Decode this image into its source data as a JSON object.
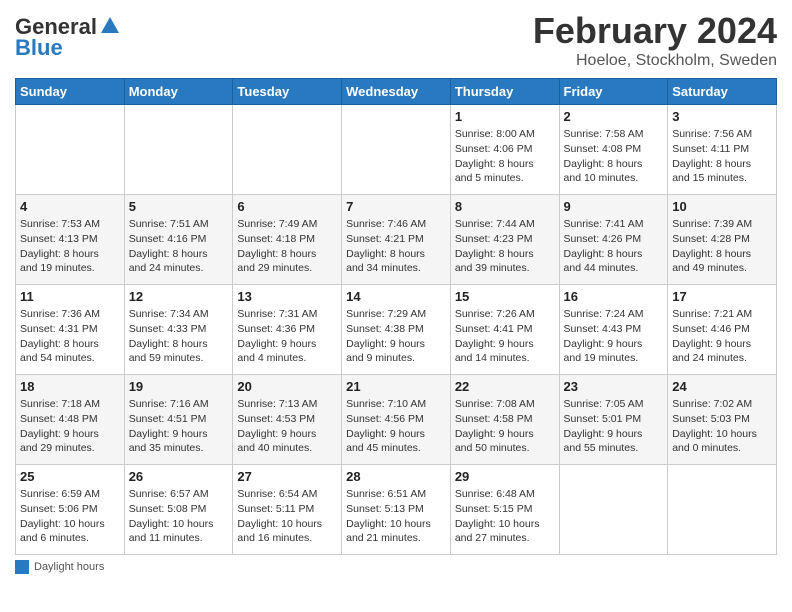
{
  "header": {
    "logo_general": "General",
    "logo_blue": "Blue",
    "month_title": "February 2024",
    "location": "Hoeloe, Stockholm, Sweden"
  },
  "weekdays": [
    "Sunday",
    "Monday",
    "Tuesday",
    "Wednesday",
    "Thursday",
    "Friday",
    "Saturday"
  ],
  "footer_label": "Daylight hours",
  "weeks": [
    [
      {
        "day": "",
        "info": ""
      },
      {
        "day": "",
        "info": ""
      },
      {
        "day": "",
        "info": ""
      },
      {
        "day": "",
        "info": ""
      },
      {
        "day": "1",
        "info": "Sunrise: 8:00 AM\nSunset: 4:06 PM\nDaylight: 8 hours\nand 5 minutes."
      },
      {
        "day": "2",
        "info": "Sunrise: 7:58 AM\nSunset: 4:08 PM\nDaylight: 8 hours\nand 10 minutes."
      },
      {
        "day": "3",
        "info": "Sunrise: 7:56 AM\nSunset: 4:11 PM\nDaylight: 8 hours\nand 15 minutes."
      }
    ],
    [
      {
        "day": "4",
        "info": "Sunrise: 7:53 AM\nSunset: 4:13 PM\nDaylight: 8 hours\nand 19 minutes."
      },
      {
        "day": "5",
        "info": "Sunrise: 7:51 AM\nSunset: 4:16 PM\nDaylight: 8 hours\nand 24 minutes."
      },
      {
        "day": "6",
        "info": "Sunrise: 7:49 AM\nSunset: 4:18 PM\nDaylight: 8 hours\nand 29 minutes."
      },
      {
        "day": "7",
        "info": "Sunrise: 7:46 AM\nSunset: 4:21 PM\nDaylight: 8 hours\nand 34 minutes."
      },
      {
        "day": "8",
        "info": "Sunrise: 7:44 AM\nSunset: 4:23 PM\nDaylight: 8 hours\nand 39 minutes."
      },
      {
        "day": "9",
        "info": "Sunrise: 7:41 AM\nSunset: 4:26 PM\nDaylight: 8 hours\nand 44 minutes."
      },
      {
        "day": "10",
        "info": "Sunrise: 7:39 AM\nSunset: 4:28 PM\nDaylight: 8 hours\nand 49 minutes."
      }
    ],
    [
      {
        "day": "11",
        "info": "Sunrise: 7:36 AM\nSunset: 4:31 PM\nDaylight: 8 hours\nand 54 minutes."
      },
      {
        "day": "12",
        "info": "Sunrise: 7:34 AM\nSunset: 4:33 PM\nDaylight: 8 hours\nand 59 minutes."
      },
      {
        "day": "13",
        "info": "Sunrise: 7:31 AM\nSunset: 4:36 PM\nDaylight: 9 hours\nand 4 minutes."
      },
      {
        "day": "14",
        "info": "Sunrise: 7:29 AM\nSunset: 4:38 PM\nDaylight: 9 hours\nand 9 minutes."
      },
      {
        "day": "15",
        "info": "Sunrise: 7:26 AM\nSunset: 4:41 PM\nDaylight: 9 hours\nand 14 minutes."
      },
      {
        "day": "16",
        "info": "Sunrise: 7:24 AM\nSunset: 4:43 PM\nDaylight: 9 hours\nand 19 minutes."
      },
      {
        "day": "17",
        "info": "Sunrise: 7:21 AM\nSunset: 4:46 PM\nDaylight: 9 hours\nand 24 minutes."
      }
    ],
    [
      {
        "day": "18",
        "info": "Sunrise: 7:18 AM\nSunset: 4:48 PM\nDaylight: 9 hours\nand 29 minutes."
      },
      {
        "day": "19",
        "info": "Sunrise: 7:16 AM\nSunset: 4:51 PM\nDaylight: 9 hours\nand 35 minutes."
      },
      {
        "day": "20",
        "info": "Sunrise: 7:13 AM\nSunset: 4:53 PM\nDaylight: 9 hours\nand 40 minutes."
      },
      {
        "day": "21",
        "info": "Sunrise: 7:10 AM\nSunset: 4:56 PM\nDaylight: 9 hours\nand 45 minutes."
      },
      {
        "day": "22",
        "info": "Sunrise: 7:08 AM\nSunset: 4:58 PM\nDaylight: 9 hours\nand 50 minutes."
      },
      {
        "day": "23",
        "info": "Sunrise: 7:05 AM\nSunset: 5:01 PM\nDaylight: 9 hours\nand 55 minutes."
      },
      {
        "day": "24",
        "info": "Sunrise: 7:02 AM\nSunset: 5:03 PM\nDaylight: 10 hours\nand 0 minutes."
      }
    ],
    [
      {
        "day": "25",
        "info": "Sunrise: 6:59 AM\nSunset: 5:06 PM\nDaylight: 10 hours\nand 6 minutes."
      },
      {
        "day": "26",
        "info": "Sunrise: 6:57 AM\nSunset: 5:08 PM\nDaylight: 10 hours\nand 11 minutes."
      },
      {
        "day": "27",
        "info": "Sunrise: 6:54 AM\nSunset: 5:11 PM\nDaylight: 10 hours\nand 16 minutes."
      },
      {
        "day": "28",
        "info": "Sunrise: 6:51 AM\nSunset: 5:13 PM\nDaylight: 10 hours\nand 21 minutes."
      },
      {
        "day": "29",
        "info": "Sunrise: 6:48 AM\nSunset: 5:15 PM\nDaylight: 10 hours\nand 27 minutes."
      },
      {
        "day": "",
        "info": ""
      },
      {
        "day": "",
        "info": ""
      }
    ]
  ]
}
